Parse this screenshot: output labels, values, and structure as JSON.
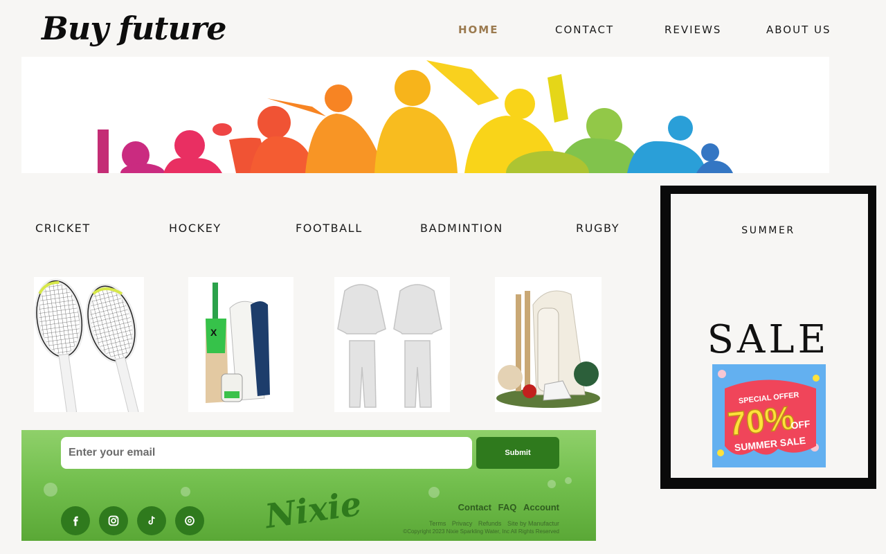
{
  "header": {
    "logo": "Buy future",
    "nav": [
      {
        "label": "HOME",
        "active": true
      },
      {
        "label": "CONTACT",
        "active": false
      },
      {
        "label": "REVIEWS",
        "active": false
      },
      {
        "label": "ABOUT US",
        "active": false
      }
    ]
  },
  "categories": [
    "CRICKET",
    "HOCKEY",
    "FOOTBALL",
    "BADMINTION",
    "RUGBY"
  ],
  "products": [
    {
      "icon": "tennis-rackets"
    },
    {
      "icon": "cricket-bat-and-pads"
    },
    {
      "icon": "tracksuit"
    },
    {
      "icon": "cricket-kit"
    }
  ],
  "newsletter": {
    "email_placeholder": "Enter your email",
    "submit_label": "Submit",
    "social_icons": [
      "facebook-icon",
      "instagram-icon",
      "tiktok-icon",
      "threads-icon"
    ],
    "brand": "Nixie",
    "links": [
      "Contact",
      "FAQ",
      "Account"
    ],
    "small_links": [
      "Terms",
      "Privacy",
      "Refunds",
      "Site by Manufactur"
    ],
    "copyright": "©Copyright 2023 Nixie Sparkling Water, Inc All Rights Reserved"
  },
  "promo": {
    "label": "SUMMER",
    "title": "SALE",
    "badge_top": "SPECIAL OFFER",
    "badge_value": "70%",
    "badge_suffix": "OFF",
    "badge_bottom": "SUMMER SALE"
  },
  "colors": {
    "background": "#f7f6f4",
    "nav_active": "#9b7a4f",
    "newsletter_green": "#74c04f",
    "button_green": "#2f7a1d",
    "badge_blue": "#63b0f0",
    "badge_red": "#f0455a",
    "badge_yellow": "#ffe23a"
  }
}
